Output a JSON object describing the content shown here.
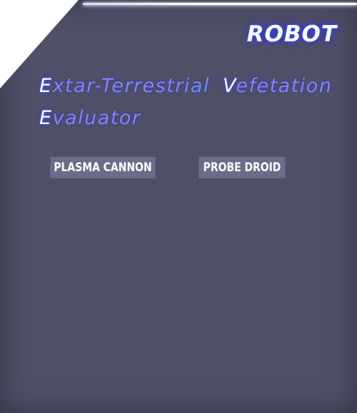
{
  "header": {
    "title": "ROBOT"
  },
  "subtitle": {
    "line1_cap1": "E",
    "line1_rest1": "xtar-Terrestrial",
    "line1_cap2": "V",
    "line1_rest2": "efetation",
    "line2_cap": "E",
    "line2_rest": "valuator"
  },
  "options": [
    {
      "label": "PLASMA CANNON"
    },
    {
      "label": "PROBE DROID"
    }
  ],
  "colors": {
    "panel": "#4f4f68",
    "button": "#6c6c88",
    "title_glow": "#3a4cff",
    "subtitle_text": "#7f86ff"
  }
}
